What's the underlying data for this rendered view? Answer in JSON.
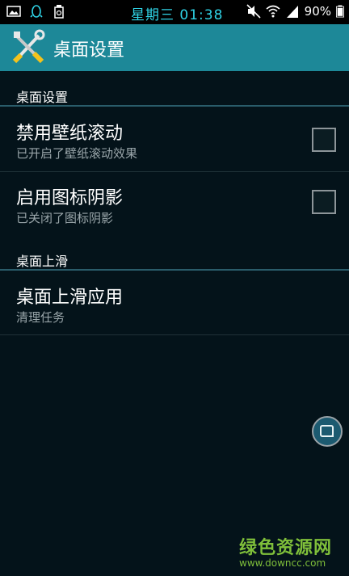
{
  "status_bar": {
    "time": "星期三 01:38",
    "battery_percent": "90%",
    "icons": [
      "image-icon",
      "qq-penguin-icon",
      "cleaner-icon",
      "mute-icon",
      "wifi-icon",
      "signal-icon",
      "battery-icon"
    ]
  },
  "app_bar": {
    "title": "桌面设置",
    "icon": "tools-icon"
  },
  "sections": [
    {
      "header": "桌面设置",
      "items": [
        {
          "title": "禁用壁纸滚动",
          "subtitle": "已开启了壁纸滚动效果",
          "checked": false
        },
        {
          "title": "启用图标阴影",
          "subtitle": "已关闭了图标阴影",
          "checked": false
        }
      ]
    },
    {
      "header": "桌面上滑",
      "items": [
        {
          "title": "桌面上滑应用",
          "subtitle": "清理任务"
        }
      ]
    }
  ],
  "watermark": {
    "name": "绿色资源网",
    "url": "www.downcc.com"
  },
  "colors": {
    "app_bar": "#1d8898",
    "background": "#04131a",
    "status_time": "#2fd3e6",
    "watermark": "#7fbf3a"
  }
}
